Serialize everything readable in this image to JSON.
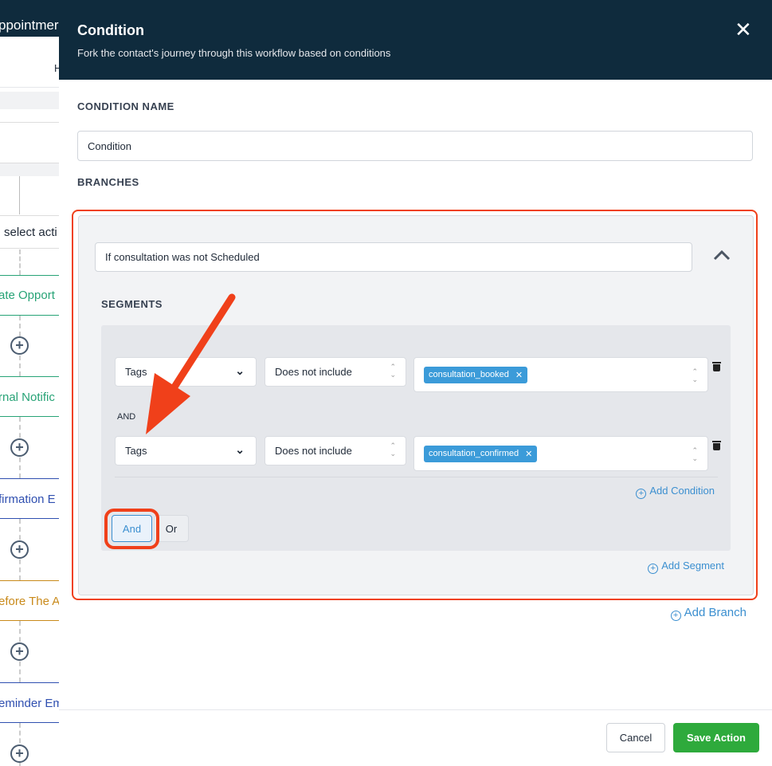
{
  "background": {
    "title_fragment": "ppointmer",
    "header_letter": "H",
    "action_placeholder": "select acti",
    "items": [
      {
        "label": "ate Opport",
        "color": "#27a376"
      },
      {
        "label": "rnal Notific",
        "color": "#27a376"
      },
      {
        "label": "firmation E",
        "color": "#2f4fb0"
      },
      {
        "label": "efore The A",
        "color": "#c98a1a"
      },
      {
        "label": "eminder Em",
        "color": "#2f4fb0"
      }
    ]
  },
  "modal": {
    "title": "Condition",
    "subtitle": "Fork the contact's journey through this workflow based on conditions",
    "condition_name_label": "CONDITION NAME",
    "condition_name_value": "Condition",
    "branches_label": "BRANCHES",
    "branch": {
      "name": "If consultation was not Scheduled",
      "segments_label": "SEGMENTS",
      "conditions": [
        {
          "field": "Tags",
          "operator": "Does not include",
          "tags": [
            "consultation_booked"
          ]
        },
        {
          "field": "Tags",
          "operator": "Does not include",
          "tags": [
            "consultation_confirmed"
          ]
        }
      ],
      "joiner": "AND",
      "add_condition": "Add Condition",
      "and_label": "And",
      "or_label": "Or",
      "add_segment": "Add Segment"
    },
    "add_branch": "Add Branch",
    "cancel": "Cancel",
    "save": "Save Action"
  },
  "colors": {
    "header": "#0f2b3d",
    "save": "#2eaa3c",
    "annotation": "#f0401a",
    "link": "#3b8fd0"
  }
}
